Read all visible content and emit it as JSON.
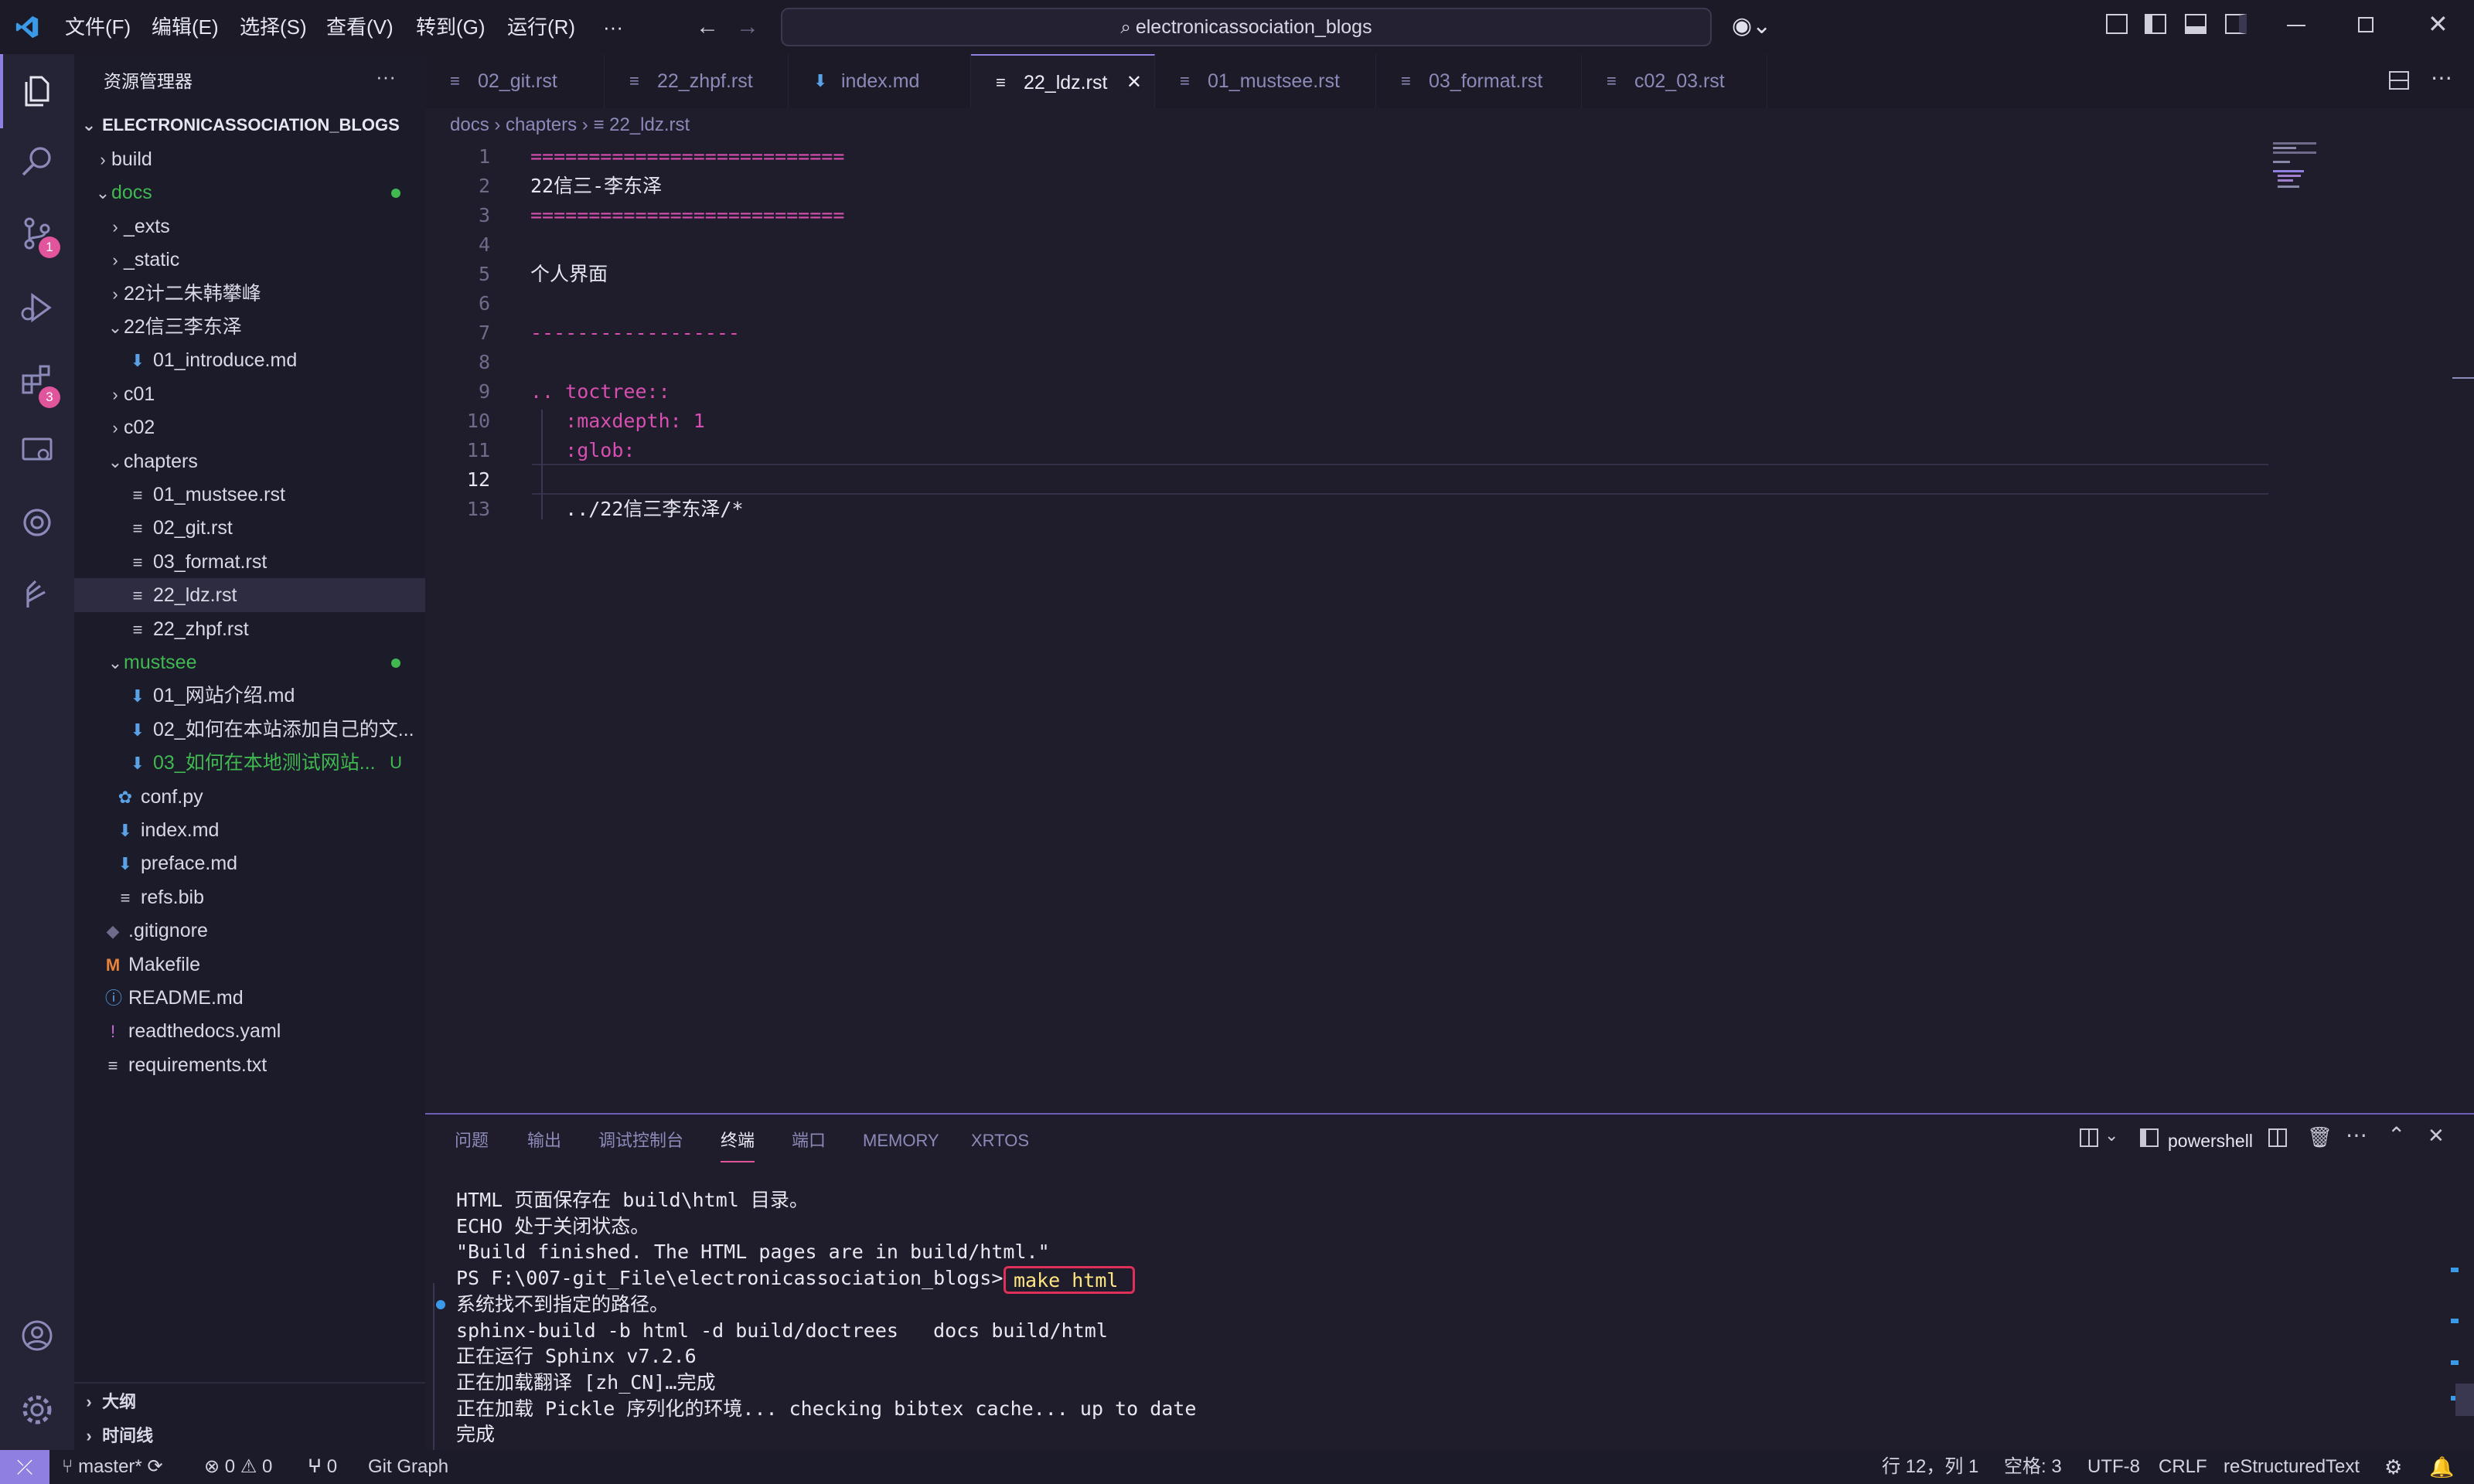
{
  "titlebar": {
    "menus": [
      "文件(F)",
      "编辑(E)",
      "选择(S)",
      "查看(V)",
      "转到(G)",
      "运行(R)",
      "···"
    ],
    "search_text": "electronicassociation_blogs"
  },
  "activity_badges": {
    "scm": "1",
    "extensions": "3"
  },
  "sidebar": {
    "title": "资源管理器",
    "more": "···",
    "root": "ELECTRONICASSOCIATION_BLOGS",
    "tree": [
      {
        "label": "build",
        "suffix": ""
      },
      {
        "label": "docs",
        "suffix": ""
      },
      {
        "label": "_exts",
        "suffix": ""
      },
      {
        "label": "_static",
        "suffix": ""
      },
      {
        "label": "22计二朱韩攀峰",
        "suffix": ""
      },
      {
        "label": "22信三李东泽",
        "suffix": ""
      },
      {
        "label": "01_introduce.md",
        "suffix": ""
      },
      {
        "label": "c01",
        "suffix": ""
      },
      {
        "label": "c02",
        "suffix": ""
      },
      {
        "label": "chapters",
        "suffix": ""
      },
      {
        "label": "01_mustsee.rst",
        "suffix": ""
      },
      {
        "label": "02_git.rst",
        "suffix": ""
      },
      {
        "label": "03_format.rst",
        "suffix": ""
      },
      {
        "label": "22_ldz.rst",
        "suffix": ""
      },
      {
        "label": "22_zhpf.rst",
        "suffix": ""
      },
      {
        "label": "mustsee",
        "suffix": ""
      },
      {
        "label": "01_网站介绍.md",
        "suffix": ""
      },
      {
        "label": "02_如何在本站添加自己的文...",
        "suffix": ""
      },
      {
        "label": "03_如何在本地测试网站...",
        "suffix": "U"
      },
      {
        "label": "conf.py",
        "suffix": ""
      },
      {
        "label": "index.md",
        "suffix": ""
      },
      {
        "label": "preface.md",
        "suffix": ""
      },
      {
        "label": "refs.bib",
        "suffix": ""
      },
      {
        "label": ".gitignore",
        "suffix": ""
      },
      {
        "label": "Makefile",
        "suffix": ""
      },
      {
        "label": "README.md",
        "suffix": ""
      },
      {
        "label": "readthedocs.yaml",
        "suffix": ""
      },
      {
        "label": "requirements.txt",
        "suffix": ""
      }
    ],
    "outline": "大纲",
    "timeline": "时间线"
  },
  "tabs": [
    "02_git.rst",
    "22_zhpf.rst",
    "index.md",
    "22_ldz.rst",
    "01_mustsee.rst",
    "03_format.rst",
    "c02_03.rst"
  ],
  "breadcrumb": [
    "docs",
    "chapters",
    "22_ldz.rst"
  ],
  "editor": {
    "line_numbers": [
      "1",
      "2",
      "3",
      "4",
      "5",
      "6",
      "7",
      "8",
      "9",
      "10",
      "11",
      "12",
      "13"
    ],
    "lines": [
      "===========================",
      "22信三-李东泽",
      "===========================",
      "",
      "个人界面",
      "",
      "------------------",
      "",
      ".. toctree::",
      "   :maxdepth: 1",
      "   :glob:",
      "",
      "   ../22信三李东泽/*"
    ]
  },
  "panel": {
    "tabs": [
      "问题",
      "输出",
      "调试控制台",
      "终端",
      "端口",
      "MEMORY",
      "XRTOS"
    ],
    "shell": "powershell",
    "terminal_lines": [
      "HTML 页面保存在 build\\html 目录。",
      "ECHO 处于关闭状态。",
      "\"Build finished. The HTML pages are in build/html.\"",
      "PS F:\\007-git_File\\electronicassociation_blogs>",
      "系统找不到指定的路径。",
      "sphinx-build -b html -d build/doctrees   docs build/html",
      "正在运行 Sphinx v7.2.6",
      "正在加载翻译 [zh_CN]…完成",
      "正在加载 Pickle 序列化的环境... checking bibtex cache... up to date",
      "完成"
    ],
    "command": "make html"
  },
  "statusbar": {
    "branch": "master*",
    "errors": "0",
    "warnings": "0",
    "ports": "0",
    "git_graph": "Git Graph",
    "position": "行 12，列 1",
    "spaces": "空格: 3",
    "encoding": "UTF-8",
    "eol": "CRLF",
    "language": "reStructuredText"
  },
  "colors": {
    "accent": "#8f7fe0",
    "badge": "#e0559b",
    "git_modified": "#3fb950",
    "markdown_icon": "#5aa2e6"
  }
}
